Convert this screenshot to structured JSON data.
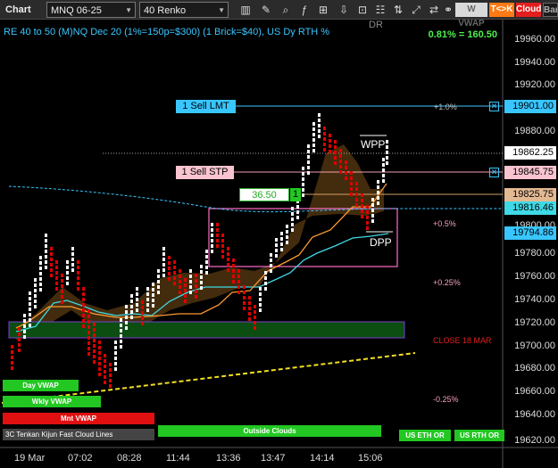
{
  "toolbar": {
    "chart_label": "Chart",
    "instrument": "MNQ 06-25",
    "bar_type": "40 Renko",
    "w_vwap": "W VWAP",
    "tk": "T<>K",
    "cloud": "Cloud",
    "bars": "Bars"
  },
  "header": {
    "title": "RE 40 to 50 (M)NQ Dec 20 (1%=150p=$300) (1 Brick=$40), US Dy RTH %",
    "pct_readout": "0.81% = 160.50"
  },
  "price_axis": {
    "labels": [
      "19960.00",
      "19940.00",
      "19920.00",
      "19880.00",
      "19840.00",
      "19800.00",
      "19780.00",
      "19760.00",
      "19740.00",
      "19720.00",
      "19700.00",
      "19680.00",
      "19660.00",
      "19640.00",
      "19620.00"
    ],
    "tag_19901": "19901.00",
    "tag_19862": "19862.25",
    "tag_19845": "19845.75",
    "tag_19825": "19825.75",
    "tag_19816": "19816.46",
    "tag_19794": "19794.86"
  },
  "time_axis": [
    "19 Mar",
    "07:02",
    "08:28",
    "11:44",
    "13:36",
    "13:47",
    "14:14",
    "15:06"
  ],
  "orders": {
    "sell_lmt": "1 Sell LMT",
    "sell_stp": "1 Sell STP",
    "position_pnl": "36.50",
    "position_qty": "1"
  },
  "annotations": {
    "p1": "+1.0%",
    "p05": "+0.5%",
    "p025": "+0.25%",
    "close": "CLOSE 18 MAR",
    "m025": "-0.25%",
    "wpp": "WPP",
    "dpp": "DPP",
    "dr": "DR"
  },
  "buttons": {
    "day_vwap": "Day VWAP",
    "wkly_vwap": "Wkly VWAP",
    "mnt_vwap": "Mnt VWAP",
    "cloud_lines": "3C Tenkan Kijun Fast Cloud Lines",
    "outside_clouds": "Outside Clouds",
    "us_eth_or": "US ETH OR",
    "us_rth_or": "US RTH OR"
  },
  "colors": {
    "background": "#000000",
    "up_brick": "#ffffff",
    "down_brick": "#e00000",
    "accent_cyan": "#39c6ff",
    "highlight_green": "#22c722"
  }
}
